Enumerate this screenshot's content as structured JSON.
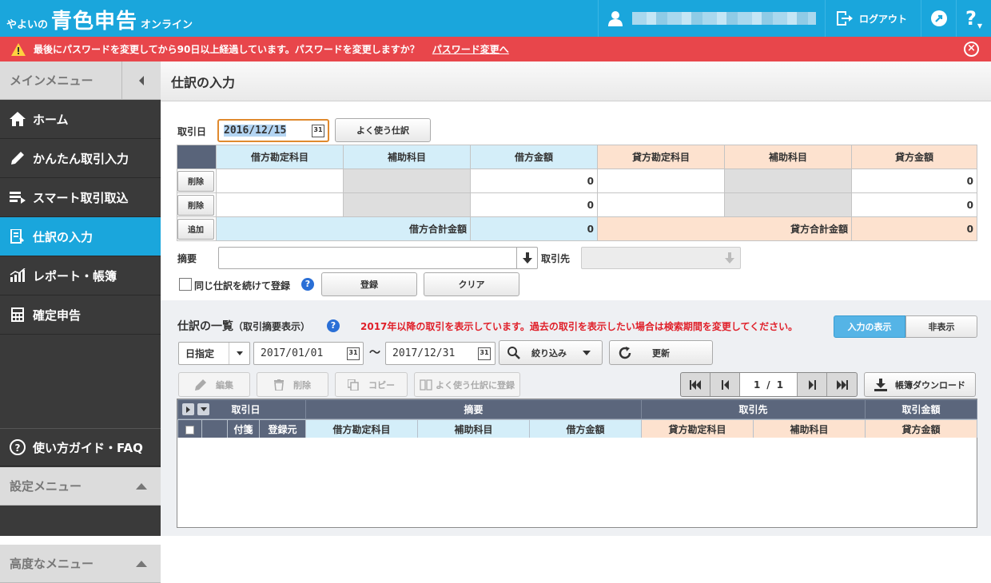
{
  "header": {
    "logo_pre": "やよいの",
    "logo_main": "青色申告",
    "logo_post": "オンライン",
    "logout": "ログアウト",
    "help": "?"
  },
  "warning": {
    "message": "最後にパスワードを変更してから90日以上経過しています。パスワードを変更しますか？",
    "link": "パスワード変更へ"
  },
  "sidebar": {
    "main_menu": "メインメニュー",
    "items": [
      {
        "label": "ホーム",
        "icon": "home-icon"
      },
      {
        "label": "かんたん取引入力",
        "icon": "pencil-icon"
      },
      {
        "label": "スマート取引取込",
        "icon": "import-icon"
      },
      {
        "label": "仕訳の入力",
        "icon": "journal-icon",
        "active": true
      },
      {
        "label": "レポート・帳簿",
        "icon": "report-icon"
      },
      {
        "label": "確定申告",
        "icon": "calculator-icon"
      }
    ],
    "guide": "使い方ガイド・FAQ",
    "settings_menu": "設定メニュー",
    "advanced_menu": "高度なメニュー"
  },
  "page": {
    "title": "仕訳の入力"
  },
  "entry": {
    "date_label": "取引日",
    "date_value": "2016/12/15",
    "favorite_button": "よく使う仕訳",
    "columns": [
      "借方勘定科目",
      "補助科目",
      "借方金額",
      "貸方勘定科目",
      "補助科目",
      "貸方金額"
    ],
    "rows": [
      {
        "button": "削除",
        "debit_amount": "0",
        "credit_amount": "0"
      },
      {
        "button": "削除",
        "debit_amount": "0",
        "credit_amount": "0"
      }
    ],
    "add_button": "追加",
    "debit_total_label": "借方合計金額",
    "debit_total": "0",
    "credit_total_label": "貸方合計金額",
    "credit_total": "0",
    "memo_label": "摘要",
    "partner_label": "取引先",
    "repeat_label": "同じ仕訳を続けて登録",
    "register_button": "登録",
    "clear_button": "クリア"
  },
  "list": {
    "title": "仕訳の一覧",
    "subtitle": "（取引摘要表示）",
    "notice": "2017年以降の取引を表示しています。過去の取引を表示したい場合は検索期間を変更してください。",
    "show_input": "入力の表示",
    "hide": "非表示",
    "period_type": "日指定",
    "from_date": "2017/01/01",
    "tilde": "〜",
    "to_date": "2017/12/31",
    "filter": "絞り込み",
    "refresh": "更新",
    "edit": "編集",
    "delete": "削除",
    "copy": "コピー",
    "add_favorite": "よく使う仕訳に登録",
    "page_current": "1",
    "page_sep": "/",
    "page_total": "1",
    "download": "帳簿ダウンロード",
    "header_row1": [
      "取引日",
      "摘要",
      "取引先",
      "取引金額"
    ],
    "header_row2": [
      "付箋",
      "登録元",
      "借方勘定科目",
      "補助科目",
      "借方金額",
      "貸方勘定科目",
      "補助科目",
      "貸方金額"
    ]
  },
  "colors": {
    "header_blue": "#1aa6dc",
    "warning_red": "#e8464b",
    "sidebar_dark": "#3a3a3a",
    "debit_blue": "#d4eef9",
    "credit_orange": "#fde2cf",
    "notice_red": "#e0202a"
  }
}
